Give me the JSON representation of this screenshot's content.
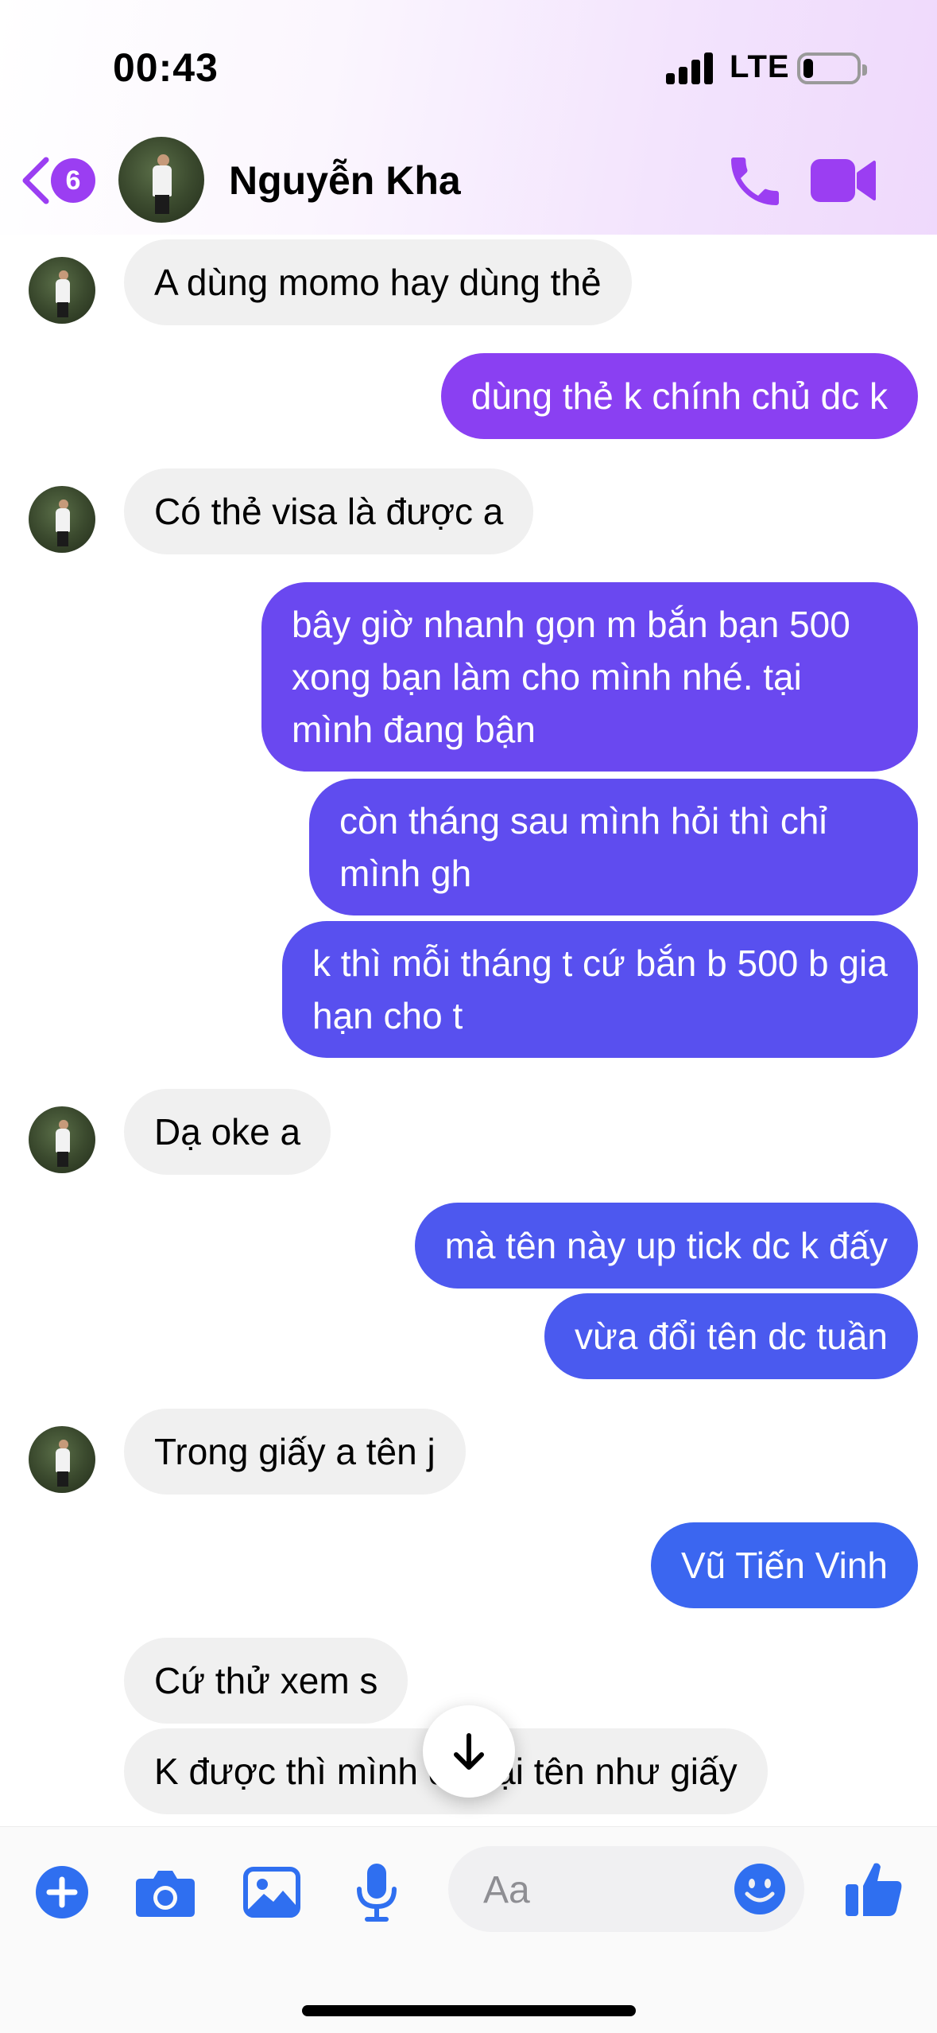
{
  "status_bar": {
    "time": "00:43",
    "network": "LTE",
    "battery_level": 0.18
  },
  "header": {
    "unread_badge": "6",
    "contact_name": "Nguyễn Kha",
    "back_icon": "chevron-left-icon",
    "call_icon": "phone-icon",
    "video_icon": "video-camera-icon",
    "accent_color": "#9b3ef2"
  },
  "messages": [
    {
      "from": "them",
      "text": "A dùng momo hay dùng thẻ"
    },
    {
      "from": "me",
      "text": "dùng thẻ k chính chủ dc k"
    },
    {
      "from": "them",
      "text": "Có thẻ visa là được a"
    },
    {
      "from": "me",
      "text": "bây giờ nhanh gọn m bắn bạn 500 xong bạn làm cho mình nhé. tại mình đang bận"
    },
    {
      "from": "me",
      "text": "còn tháng sau mình hỏi thì chỉ mình gh"
    },
    {
      "from": "me",
      "text": "k thì mỗi tháng t cứ bắn b 500 b gia hạn cho t"
    },
    {
      "from": "them",
      "text": "Dạ oke a"
    },
    {
      "from": "me",
      "text": "mà tên này up tick dc k đấy"
    },
    {
      "from": "me",
      "text": "vừa đổi tên dc tuần"
    },
    {
      "from": "them",
      "text": "Trong giấy a tên j"
    },
    {
      "from": "me",
      "text": "Vũ Tiến Vinh"
    },
    {
      "from": "them",
      "text": "Cứ thử xem s"
    },
    {
      "from": "them",
      "text": "K được thì mình đổi lại tên như giấy"
    }
  ],
  "bubble_colors": {
    "incoming": "#f0f0f0",
    "outgoing_top": "#8a3ff0",
    "outgoing_mid": "#5b50ee",
    "outgoing_bottom": "#3b66f0"
  },
  "scroll_button_icon": "arrow-down-icon",
  "composer": {
    "placeholder": "Aa",
    "icons": [
      "plus-icon",
      "camera-icon",
      "image-icon",
      "microphone-icon",
      "emoji-icon",
      "thumbs-up-icon"
    ],
    "icon_color": "#2f6ff0"
  }
}
